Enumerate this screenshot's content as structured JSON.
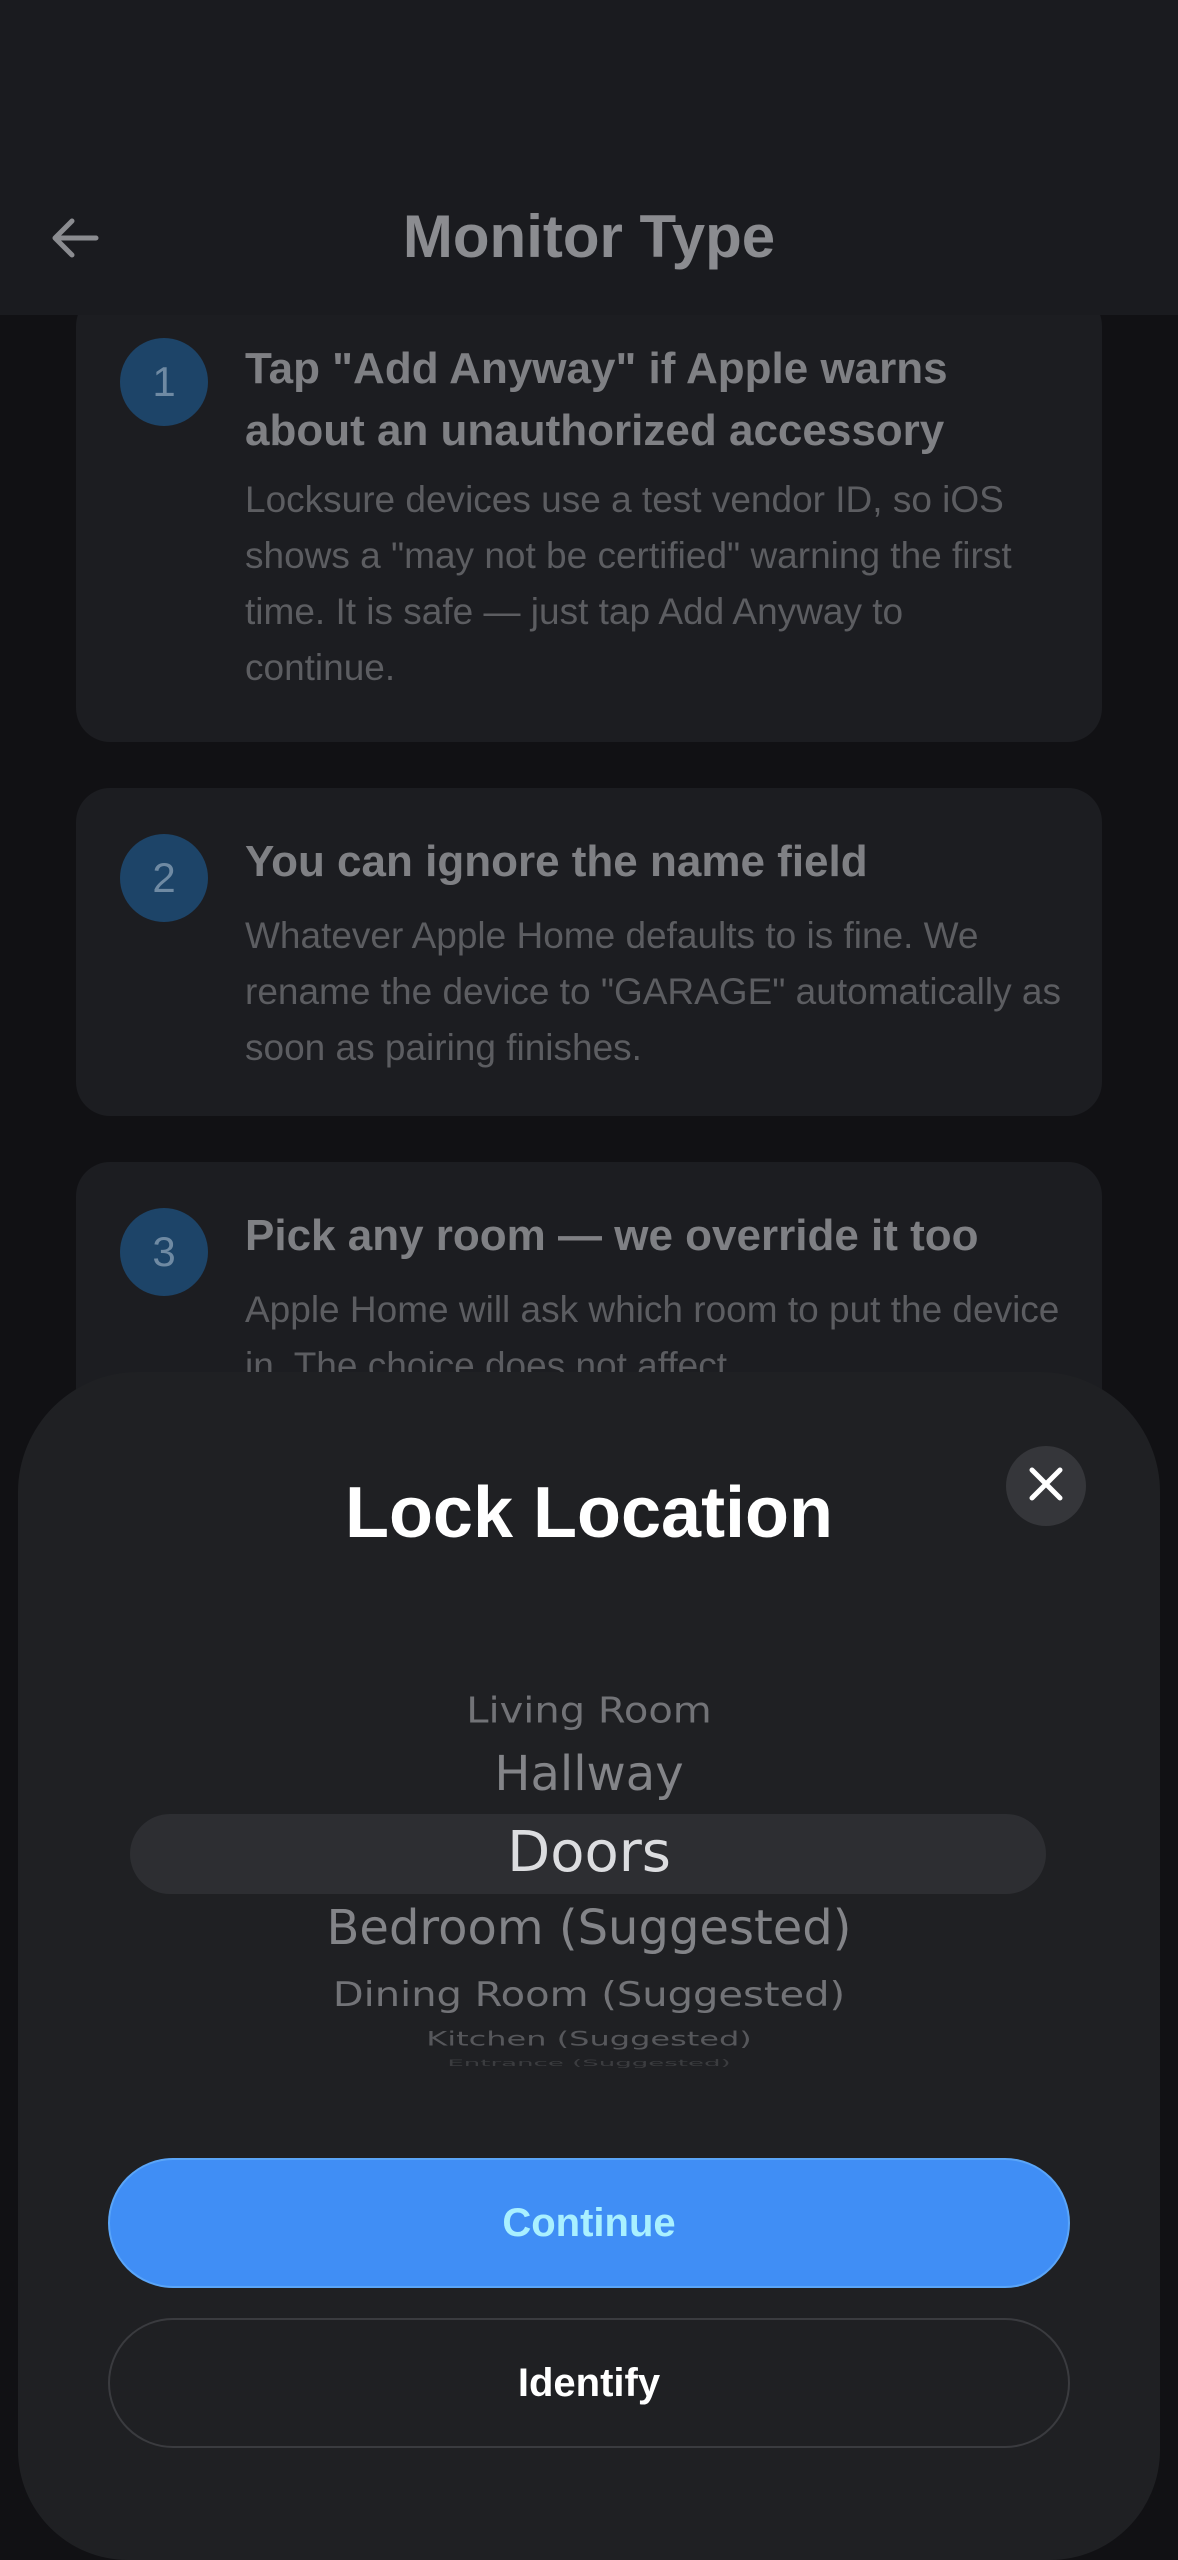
{
  "header": {
    "title": "Monitor Type",
    "back_icon": "arrow-left-icon"
  },
  "steps": [
    {
      "number": "1",
      "title": "Tap \"Add Anyway\" if Apple warns about an unauthorized accessory",
      "body": "Locksure devices use a test vendor ID, so iOS shows a \"may not be certified\" warning the first time. It is safe — just tap Add Anyway to continue."
    },
    {
      "number": "2",
      "title": "You can ignore the name field",
      "body": "Whatever Apple Home defaults to is fine. We rename the device to \"GARAGE\" automatically as soon as pairing finishes."
    },
    {
      "number": "3",
      "title": "Pick any room — we override it too",
      "body": "Apple Home will ask which room to put the device in. The choice does not affect"
    }
  ],
  "sheet": {
    "title": "Lock Location",
    "close_icon": "close-icon",
    "picker_options": [
      "Living Room",
      "Hallway",
      "Doors",
      "Bedroom (Suggested)",
      "Dining Room (Suggested)",
      "Kitchen (Suggested)",
      "Entrance (Suggested)"
    ],
    "selected_option": "Doors",
    "continue_label": "Continue",
    "identify_label": "Identify"
  },
  "colors": {
    "accent": "#408ef5",
    "background": "#111114",
    "sheet": "#1f2023",
    "step_badge": "#1d4468"
  }
}
